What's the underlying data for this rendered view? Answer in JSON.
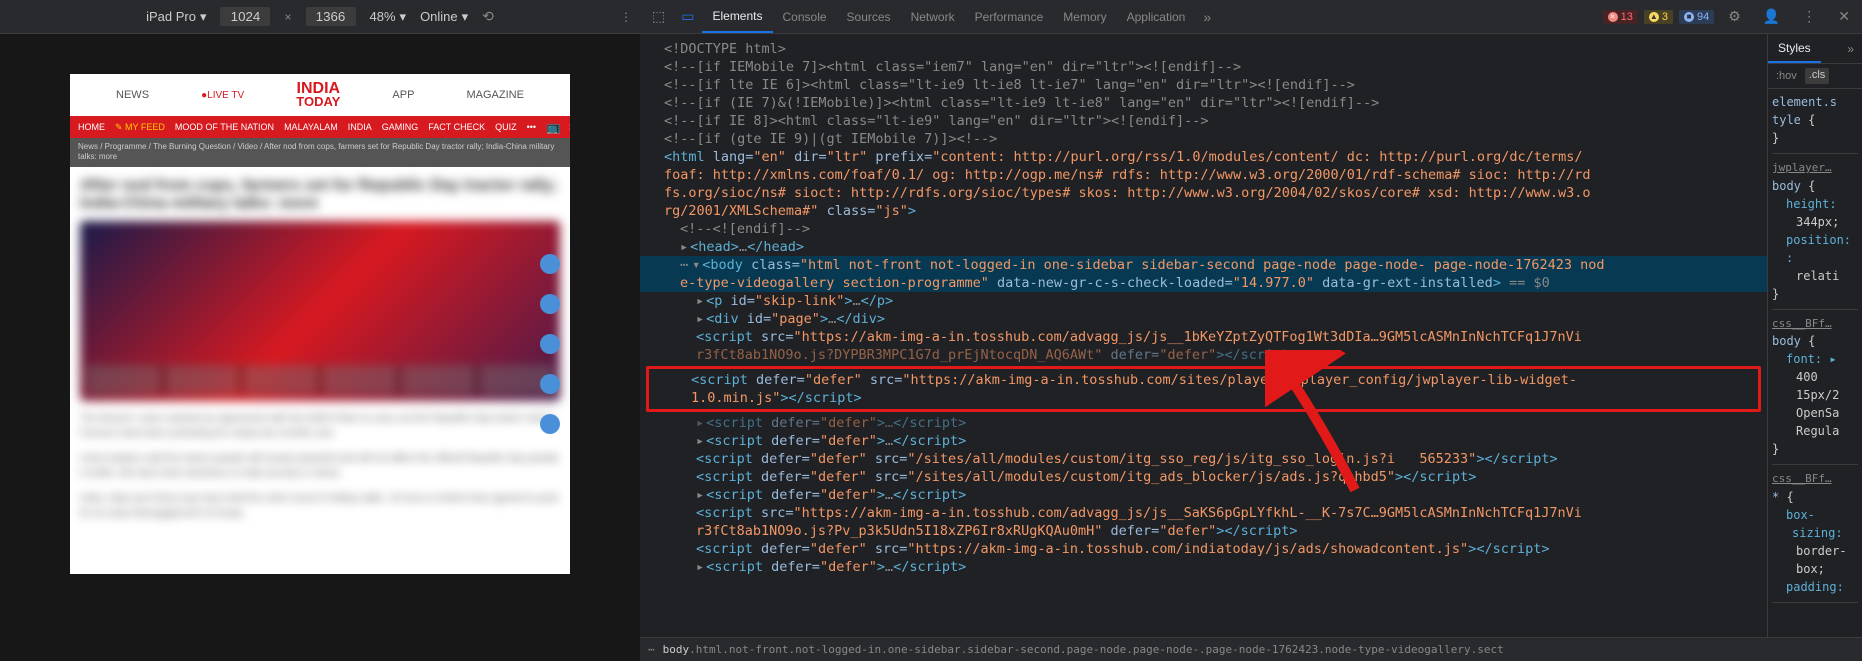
{
  "deviceToolbar": {
    "device": "iPad Pro",
    "width": "1024",
    "height": "1366",
    "zoom": "48%",
    "throttle": "Online"
  },
  "devtoolsTabs": {
    "elements": "Elements",
    "console": "Console",
    "sources": "Sources",
    "network": "Network",
    "performance": "Performance",
    "memory": "Memory",
    "application": "Application"
  },
  "badges": {
    "errors": "13",
    "warnings": "3",
    "info": "94"
  },
  "webpage": {
    "nav": {
      "news": "NEWS",
      "livetv": "LIVE TV",
      "app": "APP",
      "magazine": "MAGAZINE"
    },
    "logo": {
      "line1": "INDIA",
      "line2": "TODAY"
    },
    "redbar": {
      "home": "HOME",
      "myfeed": "MY FEED",
      "mood": "MOOD OF THE NATION",
      "malayalam": "MALAYALAM",
      "india": "INDIA",
      "gaming": "GAMING",
      "factcheck": "FACT CHECK",
      "quiz": "QUIZ"
    },
    "breadcrumb": "News / Programme / The Burning Question / Video / After nod from cops, farmers set for Republic Day tractor rally; India-China military talks: more"
  },
  "domLines": {
    "doctype": "<!DOCTYPE html>",
    "c1": "<!--[if IEMobile 7]><html class=\"iem7\" lang=\"en\" dir=\"ltr\"><![endif]-->",
    "c2": "<!--[if lte IE 6]><html class=\"lt-ie9 lt-ie8 lt-ie7\" lang=\"en\" dir=\"ltr\"><![endif]-->",
    "c3": "<!--[if (IE 7)&(!IEMobile)]><html class=\"lt-ie9 lt-ie8\" lang=\"en\" dir=\"ltr\"><![endif]-->",
    "c4": "<!--[if IE 8]><html class=\"lt-ie9\" lang=\"en\" dir=\"ltr\"><![endif]-->",
    "c5": "<!--[if (gte IE 9)|(gt IEMobile 7)]><!-->",
    "c6": "<!--<![endif]-->",
    "htmlOpen": {
      "pre": "<html ",
      "attrs": "lang=\"en\" dir=\"ltr\" prefix=\"content: http://purl.org/rss/1.0/modules/content/ dc: http://purl.org/dc/terms/ foaf: http://xmlns.com/foaf/0.1/ og: http://ogp.me/ns# rdfs: http://www.w3.org/2000/01/rdf-schema# sioc: http://rdfs.org/sioc/ns# sioct: http://rdfs.org/sioc/types# skos: http://www.w3.org/2004/02/skos/core# xsd: http://www.w3.org/2001/XMLSchema#\" class=\"js\""
    },
    "head": "<head>…</head>",
    "bodyOpen": "<body class=\"html not-front not-logged-in one-sidebar sidebar-second page-node page-node- page-node-1762423 node-type-videogallery section-programme\" data-new-gr-c-s-check-loaded=\"14.977.0\" data-gr-ext-installed>",
    "bodyEq": " == $0",
    "skipLink": "<p id=\"skip-link\">…</p>",
    "divPage": "<div id=\"page\">…</div>",
    "script1a": "<script src=\"https://akm-img-a-in.tosshub.com/advagg_js/js__1bKeYZptZyQTFog1Wt3dDIa…9GM5lcASMnInNchTCFq1J7nVi",
    "script1b": "r3fCt8ab1NO9o.js?DYPBR3MPC1G7d_prEjNtocqDN_AQ6AWt\" defer=\"defer\"></script>",
    "scriptHLa": "<script defer=\"defer\" src=\"https://akm-img-a-in.tosshub.com/sites/player/jwplayer_config/jwplayer-lib-widget-",
    "scriptHLb": "1.0.min.js\"></script>",
    "scriptD1": "<script defer=\"defer\">…</script>",
    "scriptD2": "<script defer=\"defer\">…</script>",
    "scriptSSO": "<script defer=\"defer\" src=\"/sites/all/modules/custom/itg_sso_reg/js/itg_sso_login.js?i   565233\"></script>",
    "scriptAds": "<script defer=\"defer\" src=\"/sites/all/modules/custom/itg_ads_blocker/js/ads.js?qnhbd5\"></script>",
    "scriptD3": "<script defer=\"defer\">…</script>",
    "script2a": "<script src=\"https://akm-img-a-in.tosshub.com/advagg_js/js__SaKS6pGpLYfkhL-__K-7s7C…9GM5lcASMnInNchTCFq1J7nVi",
    "script2b": "r3fCt8ab1NO9o.js?Pv_p3k5Udn5I18xZP6Ir8xRUgKQAu0mH\" defer=\"defer\"></script>",
    "scriptShow": "<script defer=\"defer\" src=\"https://akm-img-a-in.tosshub.com/indiatoday/js/ads/showadcontent.js\"></script>",
    "scriptD4": "<script defer=\"defer\">…</script>"
  },
  "breadcrumbBar": "body html.not-front.not-logged-in.one-sidebar.sidebar-second.page-node.page-node-.page-node-1762423.node-type-videogallery.sect",
  "stylesPanel": {
    "tab": "Styles",
    "hov": ":hov",
    "cls": ".cls",
    "entry1": {
      "text": "element.style {",
      "close": "}"
    },
    "entry2": {
      "src": "jwplayer…",
      "sel": "body {",
      "p1": "height:",
      "v1": "344px;",
      "p2": "position:",
      "v2": "relati…",
      "close": "}"
    },
    "entry3": {
      "src": "css__BFf…",
      "sel": "body {",
      "p1": "font:",
      "v1": "400 15px/2… OpenSa… Regula…",
      "close": "}"
    },
    "entry4": {
      "src": "css__BFf…",
      "sel": "* {",
      "p1": "box-sizing:",
      "v1": "border-box;",
      "p2": "padding:"
    }
  }
}
